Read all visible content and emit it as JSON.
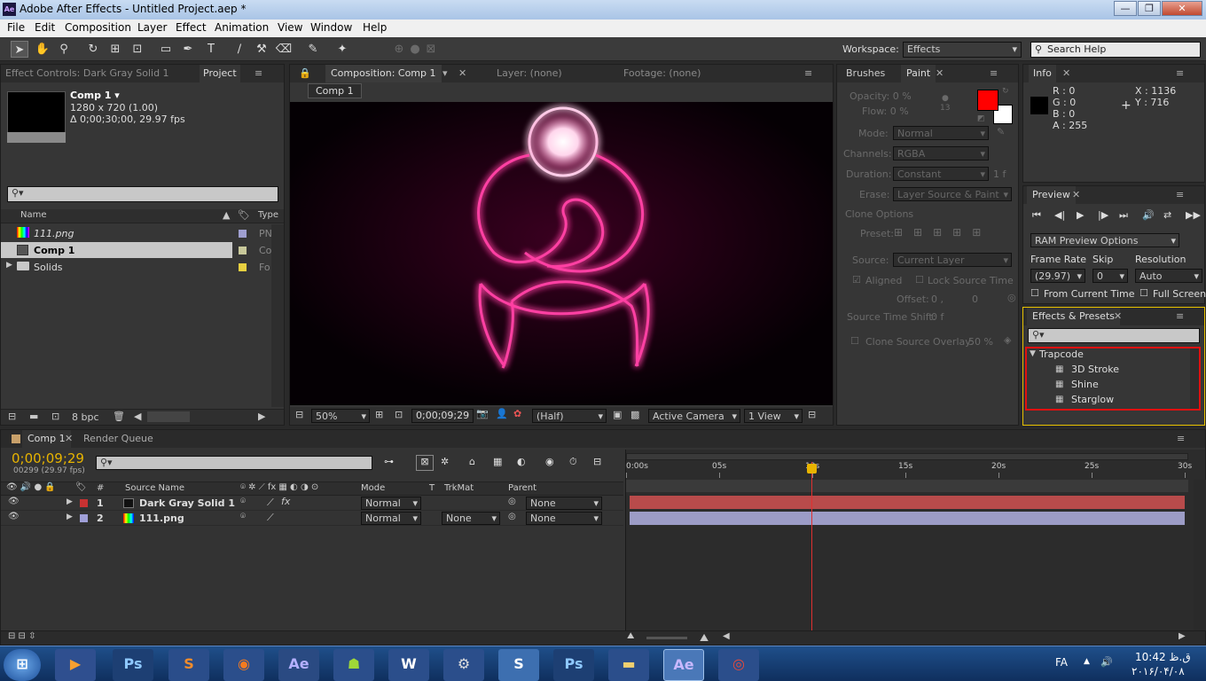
{
  "app": {
    "title": "Adobe After Effects - Untitled Project.aep *",
    "logo": "Ae"
  },
  "menu": [
    "File",
    "Edit",
    "Composition",
    "Layer",
    "Effect",
    "Animation",
    "View",
    "Window",
    "Help"
  ],
  "workspace": {
    "label": "Workspace:",
    "value": "Effects",
    "search_placeholder": "Search Help"
  },
  "project_panel": {
    "tab_effect_controls": "Effect Controls: Dark Gray Solid 1",
    "tab_project": "Project",
    "comp_name": "Comp 1 ▾",
    "comp_size": "1280 x 720 (1.00)",
    "comp_dur": "Δ 0;00;30;00, 29.97 fps",
    "col_name": "Name",
    "col_type": "Type",
    "items": [
      {
        "name": "111.png",
        "type": "PN",
        "label_color": "#9f9fd0"
      },
      {
        "name": "Comp 1",
        "type": "Co",
        "label_color": "#c8c89a"
      },
      {
        "name": "Solids",
        "type": "Fo",
        "label_color": "#e8d040"
      }
    ],
    "bpc": "8 bpc"
  },
  "comp_panel": {
    "tab": "Composition: Comp 1",
    "layer_tab": "Layer: (none)",
    "footage_tab": "Footage: (none)",
    "breadcrumb": "Comp 1",
    "zoom": "50%",
    "timecode": "0;00;09;29",
    "resolution": "(Half)",
    "camera": "Active Camera",
    "views": "1 View"
  },
  "paint_panel": {
    "tab_brushes": "Brushes",
    "tab_paint": "Paint",
    "opacity": "Opacity: 0 %",
    "flow": "Flow: 0 %",
    "brush_size": "13",
    "mode_label": "Mode:",
    "mode": "Normal",
    "channels_label": "Channels:",
    "channels": "RGBA",
    "duration_label": "Duration:",
    "duration": "Constant",
    "duration_val": "1 f",
    "erase_label": "Erase:",
    "erase": "Layer Source & Paint",
    "clone_options": "Clone Options",
    "preset_label": "Preset:",
    "source_label": "Source:",
    "source": "Current Layer",
    "aligned": "Aligned",
    "lock_source": "Lock Source Time",
    "offset_label": "Offset:",
    "offset_x": "0 ,",
    "offset_y": "0",
    "source_shift": "Source Time Shift:",
    "source_shift_val": "0 f",
    "clone_overlay": "Clone Source Overlay:",
    "clone_overlay_val": "50 %",
    "fg_color": "#ff0000",
    "bg_color": "#ffffff"
  },
  "info_panel": {
    "tab": "Info",
    "r": "R : 0",
    "g": "G : 0",
    "b": "B : 0",
    "a": "A :  255",
    "x": "X : 1136",
    "y": "Y : 716"
  },
  "preview_panel": {
    "tab": "Preview",
    "ram_options": "RAM Preview Options",
    "frame_rate_label": "Frame Rate",
    "skip_label": "Skip",
    "resolution_label": "Resolution",
    "frame_rate": "(29.97)",
    "skip": "0",
    "resolution": "Auto",
    "from_current": "From Current Time",
    "full_screen": "Full Screen"
  },
  "effects_panel": {
    "tab": "Effects & Presets",
    "category": "Trapcode",
    "items": [
      "3D Stroke",
      "Shine",
      "Starglow"
    ]
  },
  "timeline": {
    "tab_comp": "Comp 1",
    "tab_render": "Render Queue",
    "timecode": "0;00;09;29",
    "frames": "00299 (29.97 fps)",
    "ruler": [
      "0:00s",
      "05s",
      "10s",
      "15s",
      "20s",
      "25s",
      "30s"
    ],
    "playhead_fraction": 0.332,
    "col_source": "Source Name",
    "col_mode": "Mode",
    "col_t": "T",
    "col_trkmat": "TrkMat",
    "col_parent": "Parent",
    "layers": [
      {
        "num": "1",
        "name": "Dark Gray Solid 1",
        "mode": "Normal",
        "trkmat": "",
        "parent": "None",
        "color": "#c83232",
        "bar_color": "#b84b4b"
      },
      {
        "num": "2",
        "name": "111.png",
        "mode": "Normal",
        "trkmat": "None",
        "parent": "None",
        "color": "#a0a0d8",
        "bar_color": "#9c9cc6"
      }
    ]
  },
  "taskbar": {
    "lang": "FA",
    "time": "10:42 ق.ظ",
    "date": "۲۰۱۶/۰۴/۰۸"
  }
}
